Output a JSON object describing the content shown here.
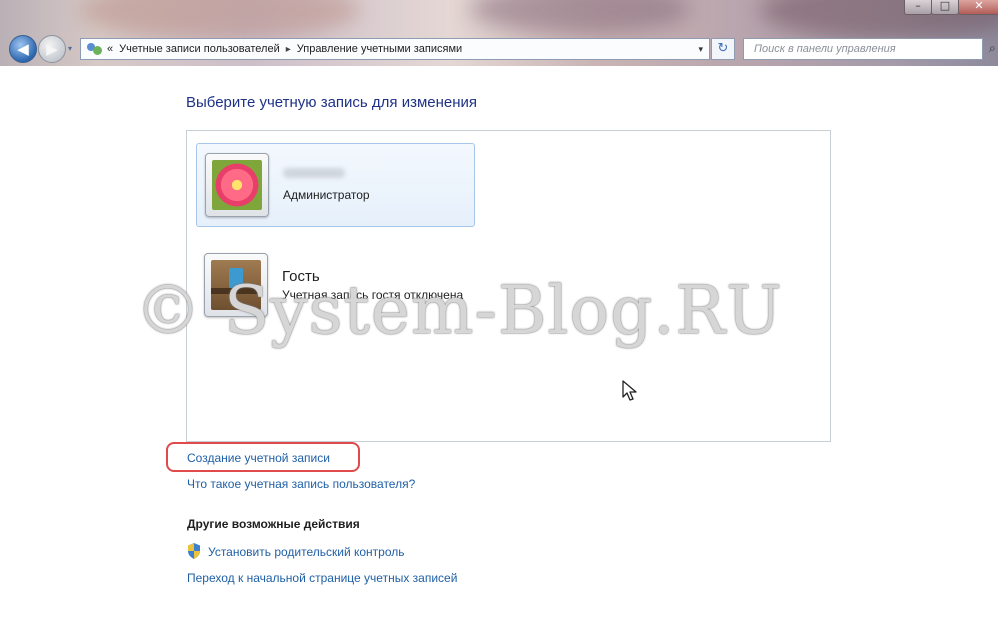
{
  "window": {
    "buttons": {
      "minimize": "–",
      "maximize": "□",
      "close": "✕"
    }
  },
  "toolbar": {
    "back_icon": "◀",
    "forward_icon": "▶",
    "nav_menu_icon": "▾",
    "breadcrumb_lead": "«",
    "breadcrumbs": [
      "Учетные записи пользователей",
      "Управление учетными записями"
    ],
    "breadcrumb_separator": "▸",
    "address_dropdown_icon": "▾",
    "refresh_icon": "↻",
    "search_placeholder": "Поиск в панели управления",
    "search_icon": "⌕"
  },
  "main": {
    "heading": "Выберите учетную запись для изменения",
    "accounts": [
      {
        "name": "",
        "role": "Администратор",
        "avatar": "flower",
        "selected": true
      },
      {
        "name": "Гость",
        "role": "Учетная запись гостя отключена",
        "avatar": "briefcase",
        "selected": false
      }
    ],
    "links": {
      "create_account": "Создание учетной записи",
      "what_is_account": "Что такое учетная запись пользователя?"
    },
    "other_actions": {
      "heading": "Другие возможные действия",
      "parental_control": "Установить родительский контроль",
      "go_to_main": "Переход к начальной странице учетных записей"
    }
  },
  "watermark": "© System-Blog.RU",
  "colors": {
    "link": "#1f5fa6",
    "heading": "#1e3287",
    "highlight": "#e04a4a",
    "selected_bg": "#e6f0fb"
  }
}
